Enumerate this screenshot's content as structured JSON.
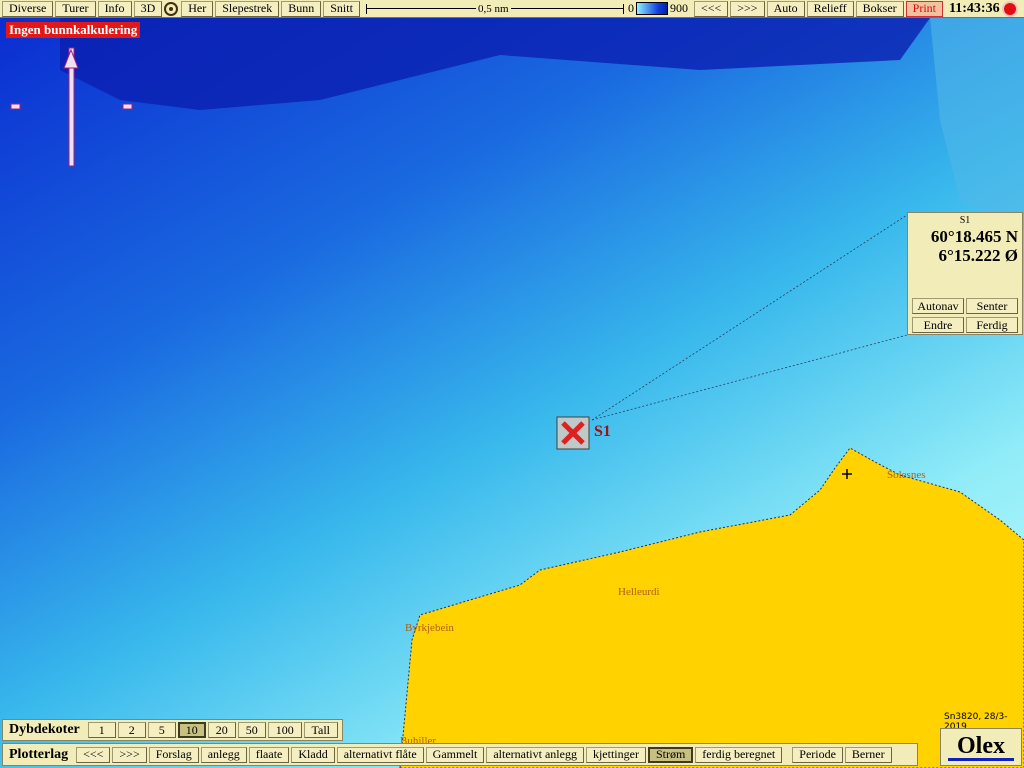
{
  "toolbar": {
    "items": [
      "Diverse",
      "Turer",
      "Info",
      "3D"
    ],
    "target_icon": "target-icon",
    "items2": [
      "Her",
      "Slepestrek",
      "Bunn",
      "Snitt"
    ],
    "scale_label": "0,5 nm",
    "depth_min": "0",
    "depth_max": "900",
    "items3": [
      "<<<",
      ">>>",
      "Auto",
      "Relieff",
      "Bokser"
    ],
    "print": "Print",
    "clock": "11:43:36",
    "sun_icon": "sun-icon"
  },
  "warning": "Ingen bunnkalkulering",
  "marker": {
    "label": "S1",
    "color": "#e02020"
  },
  "panel": {
    "name": "S1",
    "lat": "60°18.465 N",
    "lon": "6°15.222 Ø",
    "buttons": [
      "Autonav",
      "Senter",
      "Endre",
      "Ferdig"
    ]
  },
  "places": [
    "Solesnes",
    "Helleurdi",
    "Byrkjebein",
    "Buhiller"
  ],
  "version": "Sn3820, 28/3-2019",
  "logo": "Olex",
  "dybdekoter": {
    "title": "Dybdekoter",
    "buttons": [
      "1",
      "2",
      "5",
      "10",
      "20",
      "50",
      "100",
      "Tall"
    ],
    "selected": "10"
  },
  "plotterlag": {
    "title": "Plotterlag",
    "buttons": [
      "<<<",
      ">>>",
      "Forslag",
      "anlegg",
      "flaate",
      "Kladd",
      "alternativt flåte",
      "Gammelt",
      "alternativt anlegg",
      "kjettinger",
      "Strøm",
      "ferdig beregnet"
    ],
    "selected": "Strøm",
    "buttons2": [
      "Periode",
      "Berner"
    ]
  },
  "colors": {
    "land": "#ffd200",
    "deep": "#0a1fb0",
    "shallow": "#a8f4f8",
    "toolbar": "#f2ecb8"
  }
}
